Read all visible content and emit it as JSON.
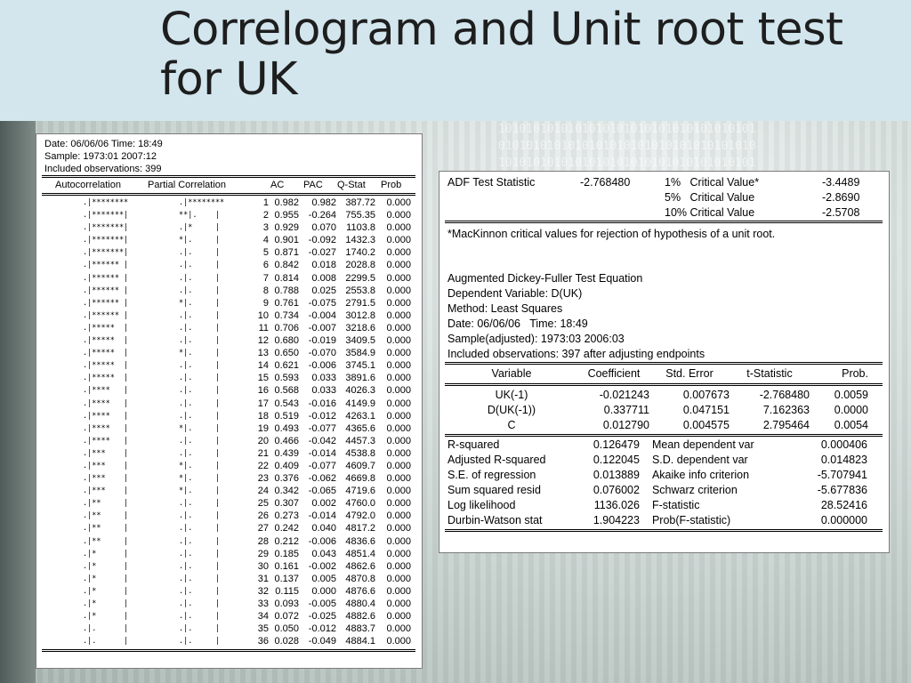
{
  "slide": {
    "title_line1": "Correlogram and Unit root test",
    "title_line2": "for UK"
  },
  "correlogram": {
    "date": "Date: 06/06/06   Time: 18:49",
    "sample": "Sample: 1973:01 2007:12",
    "obs": "Included observations: 399",
    "headers": [
      "Autocorrelation",
      "Partial Correlation",
      "AC",
      "PAC",
      "Q-Stat",
      "Prob"
    ],
    "rows": [
      [
        ".|********",
        ".|********",
        "1",
        "0.982",
        "0.982",
        "387.72",
        "0.000"
      ],
      [
        ".|*******|",
        "**|.    |",
        "2",
        "0.955",
        "-0.264",
        "755.35",
        "0.000"
      ],
      [
        ".|*******|",
        ".|*     |",
        "3",
        "0.929",
        "0.070",
        "1103.8",
        "0.000"
      ],
      [
        ".|*******|",
        "*|.     |",
        "4",
        "0.901",
        "-0.092",
        "1432.3",
        "0.000"
      ],
      [
        ".|*******|",
        ".|.     |",
        "5",
        "0.871",
        "-0.027",
        "1740.2",
        "0.000"
      ],
      [
        ".|****** |",
        ".|.     |",
        "6",
        "0.842",
        "0.018",
        "2028.8",
        "0.000"
      ],
      [
        ".|****** |",
        ".|.     |",
        "7",
        "0.814",
        "0.008",
        "2299.5",
        "0.000"
      ],
      [
        ".|****** |",
        ".|.     |",
        "8",
        "0.788",
        "0.025",
        "2553.8",
        "0.000"
      ],
      [
        ".|****** |",
        "*|.     |",
        "9",
        "0.761",
        "-0.075",
        "2791.5",
        "0.000"
      ],
      [
        ".|****** |",
        ".|.     |",
        "10",
        "0.734",
        "-0.004",
        "3012.8",
        "0.000"
      ],
      [
        ".|*****  |",
        ".|.     |",
        "11",
        "0.706",
        "-0.007",
        "3218.6",
        "0.000"
      ],
      [
        ".|*****  |",
        ".|.     |",
        "12",
        "0.680",
        "-0.019",
        "3409.5",
        "0.000"
      ],
      [
        ".|*****  |",
        "*|.     |",
        "13",
        "0.650",
        "-0.070",
        "3584.9",
        "0.000"
      ],
      [
        ".|*****  |",
        ".|.     |",
        "14",
        "0.621",
        "-0.006",
        "3745.1",
        "0.000"
      ],
      [
        ".|*****  |",
        ".|.     |",
        "15",
        "0.593",
        "0.033",
        "3891.6",
        "0.000"
      ],
      [
        ".|****   |",
        ".|.     |",
        "16",
        "0.568",
        "0.033",
        "4026.3",
        "0.000"
      ],
      [
        ".|****   |",
        ".|.     |",
        "17",
        "0.543",
        "-0.016",
        "4149.9",
        "0.000"
      ],
      [
        ".|****   |",
        ".|.     |",
        "18",
        "0.519",
        "-0.012",
        "4263.1",
        "0.000"
      ],
      [
        ".|****   |",
        "*|.     |",
        "19",
        "0.493",
        "-0.077",
        "4365.6",
        "0.000"
      ],
      [
        ".|****   |",
        ".|.     |",
        "20",
        "0.466",
        "-0.042",
        "4457.3",
        "0.000"
      ],
      [
        ".|***    |",
        ".|.     |",
        "21",
        "0.439",
        "-0.014",
        "4538.8",
        "0.000"
      ],
      [
        ".|***    |",
        "*|.     |",
        "22",
        "0.409",
        "-0.077",
        "4609.7",
        "0.000"
      ],
      [
        ".|***    |",
        "*|.     |",
        "23",
        "0.376",
        "-0.062",
        "4669.8",
        "0.000"
      ],
      [
        ".|***    |",
        "*|.     |",
        "24",
        "0.342",
        "-0.065",
        "4719.6",
        "0.000"
      ],
      [
        ".|**     |",
        ".|.     |",
        "25",
        "0.307",
        "0.002",
        "4760.0",
        "0.000"
      ],
      [
        ".|**     |",
        ".|.     |",
        "26",
        "0.273",
        "-0.014",
        "4792.0",
        "0.000"
      ],
      [
        ".|**     |",
        ".|.     |",
        "27",
        "0.242",
        "0.040",
        "4817.2",
        "0.000"
      ],
      [
        ".|**     |",
        ".|.     |",
        "28",
        "0.212",
        "-0.006",
        "4836.6",
        "0.000"
      ],
      [
        ".|*      |",
        ".|.     |",
        "29",
        "0.185",
        "0.043",
        "4851.4",
        "0.000"
      ],
      [
        ".|*      |",
        ".|.     |",
        "30",
        "0.161",
        "-0.002",
        "4862.6",
        "0.000"
      ],
      [
        ".|*      |",
        ".|.     |",
        "31",
        "0.137",
        "0.005",
        "4870.8",
        "0.000"
      ],
      [
        ".|*      |",
        ".|.     |",
        "32",
        "0.115",
        "0.000",
        "4876.6",
        "0.000"
      ],
      [
        ".|*      |",
        ".|.     |",
        "33",
        "0.093",
        "-0.005",
        "4880.4",
        "0.000"
      ],
      [
        ".|*      |",
        ".|.     |",
        "34",
        "0.072",
        "-0.025",
        "4882.6",
        "0.000"
      ],
      [
        ".|.      |",
        ".|.     |",
        "35",
        "0.050",
        "-0.012",
        "4883.7",
        "0.000"
      ],
      [
        ".|.      |",
        ".|.     |",
        "36",
        "0.028",
        "-0.049",
        "4884.1",
        "0.000"
      ]
    ]
  },
  "adf": {
    "stat_label": "ADF Test Statistic",
    "stat_value": "-2.768480",
    "critical": [
      [
        "1%   Critical Value*",
        "-3.4489"
      ],
      [
        "5%   Critical Value",
        "-2.8690"
      ],
      [
        "10% Critical Value",
        "-2.5708"
      ]
    ],
    "note": "*MacKinnon critical values for rejection of hypothesis of a unit root.",
    "eq_lines": [
      "Augmented Dickey-Fuller Test Equation",
      "Dependent Variable: D(UK)",
      "Method: Least Squares",
      "Date: 06/06/06   Time: 18:49",
      "Sample(adjusted): 1973:03 2006:03",
      "Included observations: 397 after adjusting endpoints"
    ],
    "coef_headers": [
      "Variable",
      "Coefficient",
      "Std. Error",
      "t-Statistic",
      "Prob."
    ],
    "coef_rows": [
      [
        "UK(-1)",
        "-0.021243",
        "0.007673",
        "-2.768480",
        "0.0059"
      ],
      [
        "D(UK(-1))",
        "0.337711",
        "0.047151",
        "7.162363",
        "0.0000"
      ],
      [
        "C",
        "0.012790",
        "0.004575",
        "2.795464",
        "0.0054"
      ]
    ],
    "stats_rows": [
      [
        "R-squared",
        "0.126479",
        "Mean dependent var",
        "0.000406"
      ],
      [
        "Adjusted R-squared",
        "0.122045",
        "S.D. dependent var",
        "0.014823"
      ],
      [
        "S.E. of regression",
        "0.013889",
        "Akaike info criterion",
        "-5.707941"
      ],
      [
        "Sum squared resid",
        "0.076002",
        "Schwarz criterion",
        "-5.677836"
      ],
      [
        "Log likelihood",
        "1136.026",
        "F-statistic",
        "28.52416"
      ],
      [
        "Durbin-Watson stat",
        "1.904223",
        "Prob(F-statistic)",
        "0.000000"
      ]
    ]
  }
}
